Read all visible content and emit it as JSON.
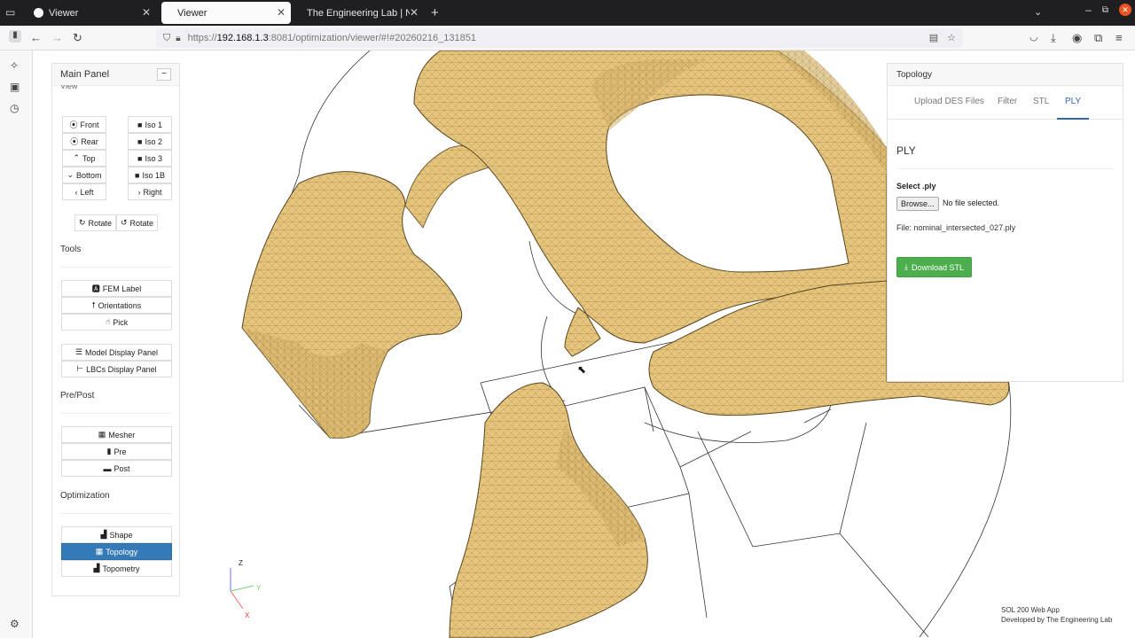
{
  "browser": {
    "tabs": [
      {
        "label": "Viewer"
      },
      {
        "label": "Viewer"
      },
      {
        "label": "The Engineering Lab | Na"
      }
    ],
    "url_prefix": "https://",
    "url_host": "192.168.1.3",
    "url_rest": ":8081/optimization/viewer/#!#20260216_131851"
  },
  "main_panel": {
    "title": "Main Panel",
    "collapse_label": "−",
    "cut_heading": "View",
    "view_buttons": {
      "front": "Front",
      "rear": "Rear",
      "top": "Top",
      "bottom": "Bottom",
      "left": "Left",
      "right": "Right",
      "iso1": "Iso 1",
      "iso2": "Iso 2",
      "iso3": "Iso 3",
      "iso1b": "Iso 1B",
      "rotate_cw": "Rotate",
      "rotate_ccw": "Rotate"
    },
    "tools_label": "Tools",
    "tools": {
      "fem_label": "FEM Label",
      "orientations": "Orientations",
      "pick": "Pick",
      "model_display": "Model Display Panel",
      "lbcs_display": "LBCs Display Panel"
    },
    "prepost_label": "Pre/Post",
    "prepost": {
      "mesher": "Mesher",
      "pre": "Pre",
      "post": "Post"
    },
    "optimization_label": "Optimization",
    "optimization": {
      "shape": "Shape",
      "topology": "Topology",
      "topometry": "Topometry"
    }
  },
  "topology_panel": {
    "title": "Topology",
    "tabs": {
      "upload": "Upload DES Files",
      "filter": "Filter",
      "stl": "STL",
      "ply": "PLY"
    },
    "section_title": "PLY",
    "select_label": "Select .ply",
    "browse_label": "Browse...",
    "no_file": "No file selected.",
    "file_text": "File: nominal_intersected_027.ply",
    "download_label": "Download STL"
  },
  "axes": {
    "z": "Z",
    "y": "Y",
    "x": "X"
  },
  "footer": {
    "line1": "SOL 200 Web App",
    "line2": "Developed by The Engineering Lab"
  },
  "colors": {
    "mesh": "#e6c57c",
    "accent": "#337ab7",
    "download": "#4cae4c",
    "tab_active": "#2d6bb5"
  }
}
